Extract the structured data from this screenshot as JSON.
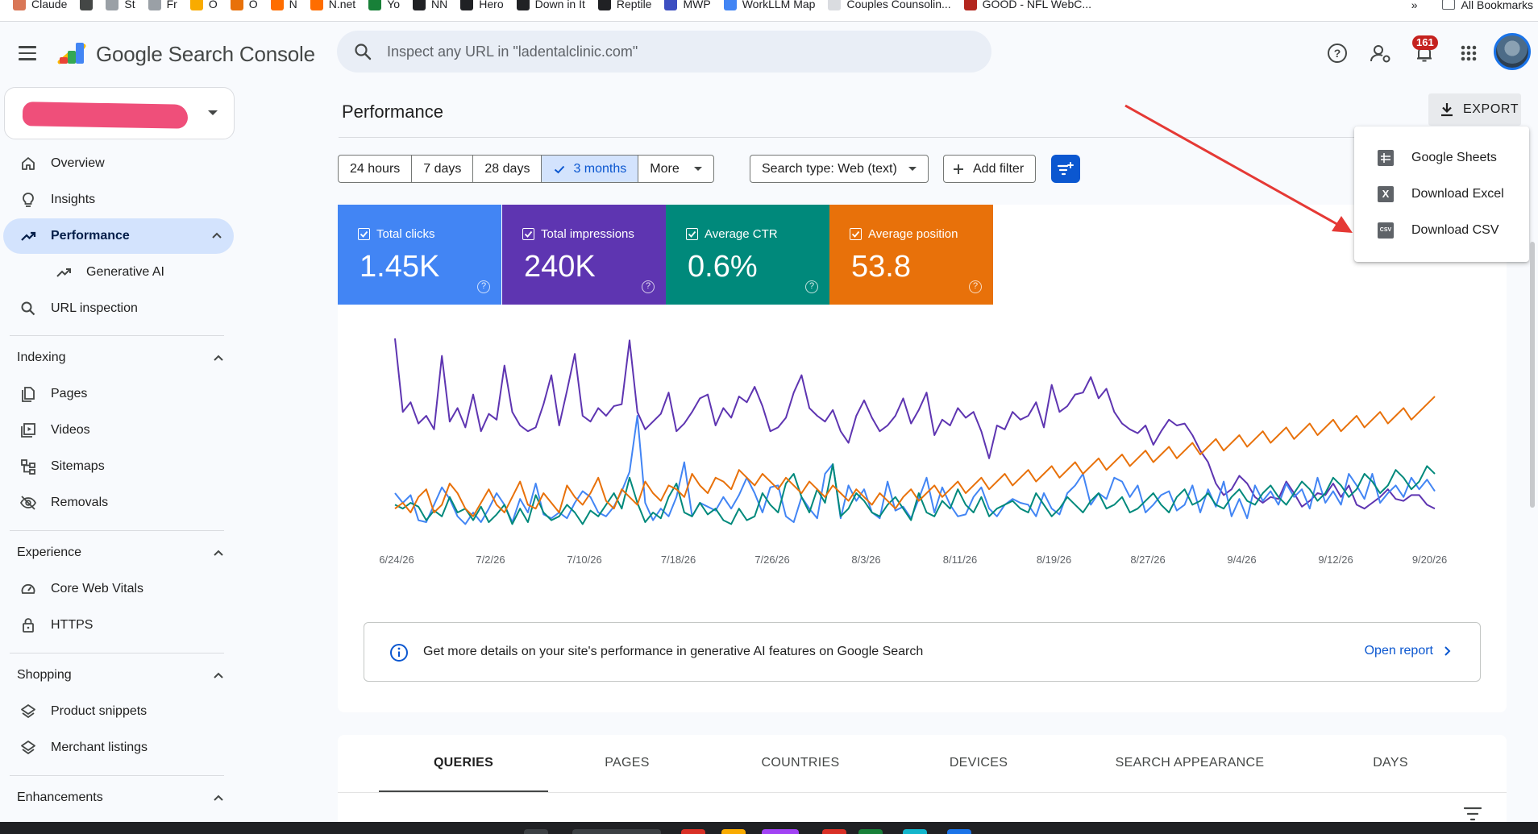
{
  "bookmarks": [
    {
      "label": "Claude",
      "color": "#d97757"
    },
    {
      "label": "",
      "color": "#444746"
    },
    {
      "label": "St",
      "color": "#9aa0a6"
    },
    {
      "label": "Fr",
      "color": "#9aa0a6"
    },
    {
      "label": "O",
      "color": "#f9ab00"
    },
    {
      "label": "O",
      "color": "#e8710a"
    },
    {
      "label": "N",
      "color": "#ff6d00"
    },
    {
      "label": "N.net",
      "color": "#ff6d00"
    },
    {
      "label": "Yo",
      "color": "#188038"
    },
    {
      "label": "NN",
      "color": "#202124"
    },
    {
      "label": "Hero",
      "color": "#202124"
    },
    {
      "label": "Down in It",
      "color": "#202124"
    },
    {
      "label": "Reptile",
      "color": "#202124"
    },
    {
      "label": "MWP",
      "color": "#3c4ec1"
    },
    {
      "label": "WorkLLM Map",
      "color": "#4285f4"
    },
    {
      "label": "Couples Counsolin...",
      "color": "#dadce0"
    },
    {
      "label": "GOOD - NFL WebC...",
      "color": "#b3261e"
    }
  ],
  "bookmarks_more": "»",
  "all_bookmarks": "All Bookmarks",
  "header": {
    "product_name": "Google Search Console",
    "search_placeholder": "Inspect any URL in \"ladentalclinic.com\"",
    "notification_count": "161"
  },
  "sidebar": {
    "items": [
      {
        "label": "Overview",
        "icon": "home-icon"
      },
      {
        "label": "Insights",
        "icon": "lightbulb-icon"
      },
      {
        "label": "Performance",
        "icon": "trending-up-icon"
      },
      {
        "label": "Generative AI",
        "icon": "trending-up-icon"
      },
      {
        "label": "URL inspection",
        "icon": "search-icon"
      }
    ],
    "indexing": {
      "title": "Indexing",
      "items": [
        {
          "label": "Pages"
        },
        {
          "label": "Videos"
        },
        {
          "label": "Sitemaps"
        },
        {
          "label": "Removals"
        }
      ]
    },
    "experience": {
      "title": "Experience",
      "items": [
        {
          "label": "Core Web Vitals"
        },
        {
          "label": "HTTPS"
        }
      ]
    },
    "shopping": {
      "title": "Shopping",
      "items": [
        {
          "label": "Product snippets"
        },
        {
          "label": "Merchant listings"
        }
      ]
    },
    "enhancements": {
      "title": "Enhancements"
    }
  },
  "main": {
    "title": "Performance",
    "export_label": "EXPORT",
    "date_ranges": [
      {
        "label": "24 hours",
        "selected": false
      },
      {
        "label": "7 days",
        "selected": false
      },
      {
        "label": "28 days",
        "selected": false
      },
      {
        "label": "3 months",
        "selected": true
      },
      {
        "label": "More",
        "selected": false
      }
    ],
    "search_type": "Search type: Web (text)",
    "add_filter": "Add filter",
    "metrics": [
      {
        "label": "Total clicks",
        "value": "1.45K",
        "color": "#4285f4"
      },
      {
        "label": "Total impressions",
        "value": "240K",
        "color": "#5e35b1"
      },
      {
        "label": "Average CTR",
        "value": "0.6%",
        "color": "#00897b"
      },
      {
        "label": "Average position",
        "value": "53.8",
        "color": "#e8710a"
      }
    ],
    "gen_ai_notice": "Get more details on your site's performance in generative AI features on Google Search",
    "open_report": "Open report",
    "tabs": [
      {
        "label": "QUERIES",
        "active": true
      },
      {
        "label": "PAGES",
        "active": false
      },
      {
        "label": "COUNTRIES",
        "active": false
      },
      {
        "label": "DEVICES",
        "active": false
      },
      {
        "label": "SEARCH APPEARANCE",
        "active": false
      },
      {
        "label": "DAYS",
        "active": false
      }
    ]
  },
  "export_menu": {
    "items": [
      {
        "label": "Google Sheets",
        "icon": "google-sheets-icon"
      },
      {
        "label": "Download Excel",
        "icon": "excel-icon"
      },
      {
        "label": "Download CSV",
        "icon": "csv-icon"
      }
    ]
  },
  "chart_data": {
    "type": "line",
    "x_ticks": [
      "6/24/26",
      "7/2/26",
      "7/10/26",
      "7/18/26",
      "7/26/26",
      "8/3/26",
      "8/11/26",
      "8/19/26",
      "8/27/26",
      "9/4/26",
      "9/12/26",
      "9/20/26"
    ],
    "grid": false,
    "series": [
      {
        "color": "#5e35b1",
        "values": [
          100,
          62,
          67,
          56,
          60,
          53,
          91,
          57,
          64,
          54,
          71,
          52,
          61,
          58,
          86,
          62,
          55,
          52,
          54,
          66,
          81,
          55,
          73,
          92,
          60,
          57,
          64,
          60,
          65,
          66,
          99,
          62,
          53,
          57,
          61,
          72,
          52,
          56,
          62,
          69,
          71,
          55,
          64,
          59,
          70,
          67,
          75,
          65,
          52,
          54,
          59,
          72,
          81,
          64,
          60,
          57,
          63,
          52,
          46,
          60,
          68,
          59,
          52,
          55,
          60,
          69,
          56,
          63,
          72,
          50,
          58,
          55,
          64,
          59,
          62,
          52,
          38,
          55,
          53,
          62,
          58,
          60,
          67,
          54,
          76,
          62,
          65,
          71,
          72,
          80,
          69,
          74,
          62,
          56,
          53,
          51,
          55,
          45,
          52,
          58,
          55,
          56,
          50,
          42,
          36,
          25,
          19,
          22,
          29,
          25,
          18,
          15,
          18,
          17,
          26,
          20,
          13,
          16,
          20,
          19,
          25,
          18,
          24,
          14,
          12,
          15,
          18,
          22,
          17,
          16,
          19,
          19,
          14,
          12
        ]
      },
      {
        "color": "#4285f4",
        "values": [
          20,
          15,
          19,
          6,
          5,
          14,
          23,
          17,
          8,
          4,
          10,
          5,
          12,
          20,
          14,
          5,
          17,
          10,
          25,
          9,
          7,
          10,
          7,
          15,
          21,
          18,
          10,
          8,
          13,
          21,
          31,
          60,
          15,
          6,
          12,
          8,
          18,
          36,
          8,
          15,
          13,
          11,
          18,
          12,
          19,
          28,
          20,
          10,
          23,
          24,
          8,
          5,
          18,
          12,
          7,
          30,
          35,
          7,
          24,
          16,
          22,
          10,
          7,
          26,
          11,
          13,
          7,
          17,
          28,
          10,
          23,
          14,
          8,
          9,
          18,
          23,
          12,
          8,
          14,
          17,
          15,
          14,
          8,
          20,
          12,
          9,
          20,
          24,
          30,
          14,
          20,
          17,
          28,
          26,
          18,
          24,
          10,
          14,
          19,
          21,
          11,
          14,
          24,
          10,
          22,
          13,
          26,
          8,
          17,
          7,
          24,
          16,
          21,
          14,
          25,
          18,
          22,
          12,
          28,
          15,
          21,
          14,
          30,
          24,
          17,
          30,
          15,
          20,
          24,
          18,
          28,
          22,
          27,
          21
        ]
      },
      {
        "color": "#00897b",
        "values": [
          14,
          12,
          15,
          13,
          6,
          11,
          8,
          18,
          10,
          12,
          6,
          13,
          5,
          9,
          14,
          4,
          12,
          5,
          19,
          10,
          6,
          8,
          14,
          10,
          4,
          11,
          8,
          14,
          20,
          12,
          28,
          15,
          5,
          10,
          7,
          18,
          25,
          10,
          8,
          15,
          9,
          12,
          6,
          4,
          12,
          6,
          8,
          20,
          14,
          10,
          25,
          30,
          18,
          10,
          22,
          15,
          35,
          8,
          12,
          20,
          16,
          10,
          8,
          14,
          18,
          12,
          6,
          20,
          10,
          8,
          16,
          12,
          22,
          14,
          10,
          18,
          8,
          12,
          14,
          16,
          12,
          10,
          20,
          14,
          8,
          12,
          18,
          14,
          10,
          16,
          20,
          12,
          14,
          18,
          10,
          12,
          16,
          20,
          14,
          10,
          18,
          22,
          14,
          16,
          20,
          14,
          12,
          18,
          22,
          16,
          14,
          20,
          24,
          18,
          14,
          20,
          26,
          22,
          16,
          20,
          28,
          24,
          18,
          22,
          30,
          26,
          20,
          24,
          32,
          28,
          22,
          26,
          34,
          30
        ]
      },
      {
        "color": "#e8710a",
        "values": [
          12,
          15,
          10,
          18,
          22,
          10,
          14,
          25,
          20,
          12,
          8,
          15,
          22,
          14,
          10,
          18,
          26,
          14,
          12,
          20,
          15,
          10,
          24,
          18,
          14,
          20,
          28,
          16,
          12,
          22,
          18,
          14,
          26,
          20,
          16,
          24,
          22,
          18,
          30,
          24,
          20,
          28,
          26,
          22,
          32,
          28,
          24,
          30,
          26,
          22,
          28,
          24,
          20,
          26,
          22,
          18,
          24,
          20,
          16,
          22,
          18,
          14,
          20,
          16,
          12,
          18,
          22,
          16,
          20,
          24,
          18,
          22,
          26,
          20,
          24,
          28,
          22,
          26,
          30,
          24,
          28,
          32,
          26,
          30,
          34,
          28,
          32,
          36,
          30,
          34,
          38,
          32,
          36,
          40,
          34,
          38,
          42,
          36,
          40,
          44,
          38,
          42,
          46,
          40,
          44,
          48,
          42,
          46,
          50,
          44,
          48,
          52,
          46,
          50,
          54,
          48,
          52,
          56,
          50,
          54,
          58,
          52,
          56,
          60,
          54,
          58,
          62,
          56,
          60,
          64,
          58,
          62,
          66,
          70
        ]
      }
    ]
  }
}
